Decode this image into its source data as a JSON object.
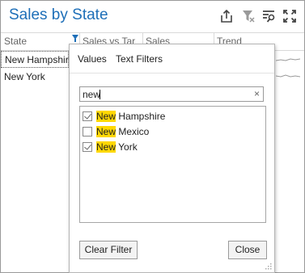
{
  "header": {
    "title": "Sales by State",
    "icons": [
      "export-icon",
      "clear-filter-icon",
      "filter-list-icon",
      "fullscreen-icon"
    ]
  },
  "grid": {
    "columns": [
      "State",
      "Sales vs Tar",
      "Sales",
      "Trend"
    ],
    "rows": [
      "New Hampshire",
      "New York"
    ]
  },
  "filter_popup": {
    "tabs": [
      "Values",
      "Text Filters"
    ],
    "active_tab": "Values",
    "search": {
      "value": "new",
      "clear_icon": "×"
    },
    "items": [
      {
        "match": "New",
        "rest": " Hampshire",
        "checked": true
      },
      {
        "match": "New",
        "rest": " Mexico",
        "checked": false
      },
      {
        "match": "New",
        "rest": " York",
        "checked": true
      }
    ],
    "clear_filter_label": "Clear Filter",
    "close_label": "Close"
  },
  "colors": {
    "accent": "#1e6fb8",
    "highlight": "#ffd800"
  }
}
